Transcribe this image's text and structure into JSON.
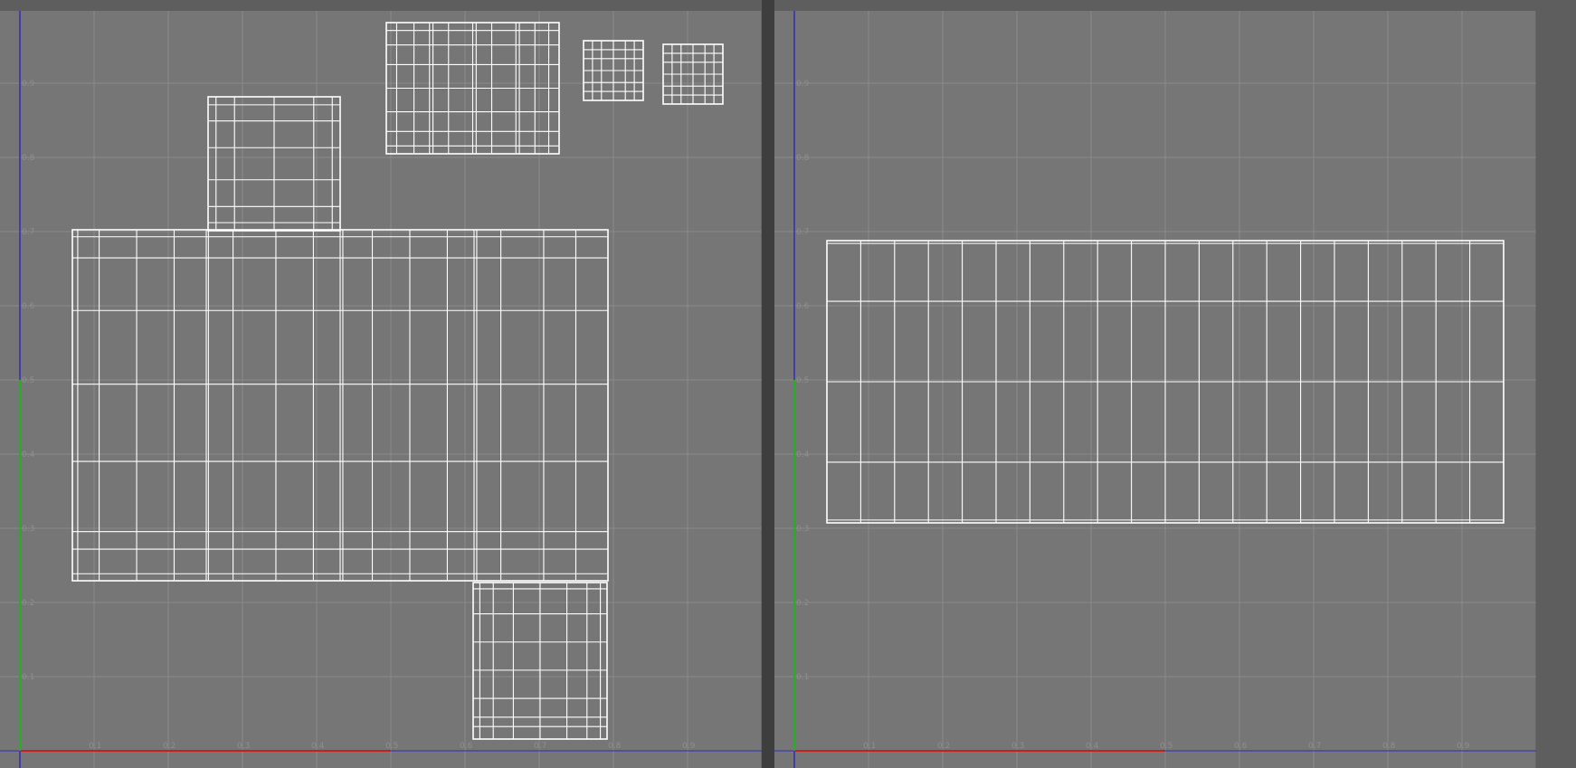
{
  "colors": {
    "background": "#767676",
    "grid": "#8a8a8a",
    "wire": "#ffffff",
    "u_axis": "#c81e1e",
    "v_axis": "#2e2eb8",
    "v_axis_lower": "#1eb41e",
    "frame": "#3e3e3e"
  },
  "viewports": [
    {
      "name": "uv-viewport-left",
      "ticks": {
        "u": [
          "0.1",
          "0.2",
          "0.3",
          "0.4",
          "0.5",
          "0.6",
          "0.7",
          "0.8",
          "0.9"
        ],
        "v": [
          "0.1",
          "0.2",
          "0.3",
          "0.4",
          "0.5",
          "0.6",
          "0.7",
          "0.8",
          "0.9"
        ]
      }
    },
    {
      "name": "uv-viewport-right",
      "ticks": {
        "u": [
          "0.1",
          "0.2",
          "0.3",
          "0.4",
          "0.5",
          "0.6",
          "0.7",
          "0.8",
          "0.9"
        ],
        "v": [
          "0.1",
          "0.2",
          "0.3",
          "0.4",
          "0.5",
          "0.6",
          "0.7",
          "0.8",
          "0.9"
        ]
      }
    }
  ]
}
